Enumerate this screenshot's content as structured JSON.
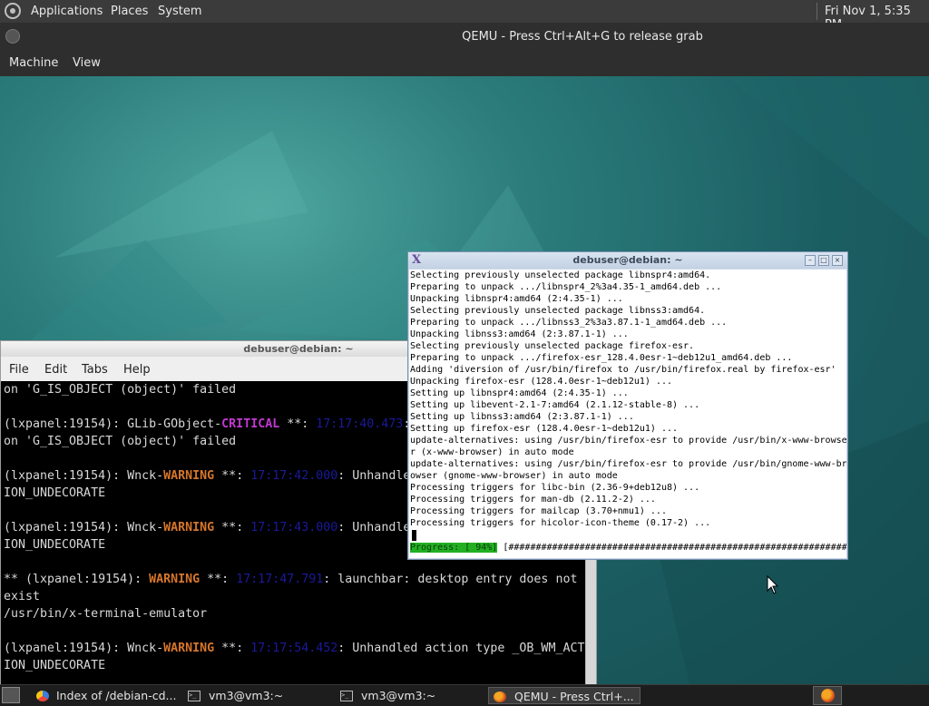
{
  "host_panel": {
    "menu": [
      "Applications",
      "Places",
      "System"
    ],
    "clock": "Fri Nov 1,  5:35 PM"
  },
  "qemu": {
    "title": "QEMU - Press Ctrl+Alt+G to release grab",
    "menu": [
      "Machine",
      "View"
    ]
  },
  "xterm": {
    "title": "debuser@debian: ~",
    "lines": [
      "Selecting previously unselected package libnspr4:amd64.",
      "Preparing to unpack .../libnspr4_2%3a4.35-1_amd64.deb ...",
      "Unpacking libnspr4:amd64 (2:4.35-1) ...",
      "Selecting previously unselected package libnss3:amd64.",
      "Preparing to unpack .../libnss3_2%3a3.87.1-1_amd64.deb ...",
      "Unpacking libnss3:amd64 (2:3.87.1-1) ...",
      "Selecting previously unselected package firefox-esr.",
      "Preparing to unpack .../firefox-esr_128.4.0esr-1~deb12u1_amd64.deb ...",
      "Adding 'diversion of /usr/bin/firefox to /usr/bin/firefox.real by firefox-esr'",
      "Unpacking firefox-esr (128.4.0esr-1~deb12u1) ...",
      "Setting up libnspr4:amd64 (2:4.35-1) ...",
      "Setting up libevent-2.1-7:amd64 (2.1.12-stable-8) ...",
      "Setting up libnss3:amd64 (2:3.87.1-1) ...",
      "Setting up firefox-esr (128.4.0esr-1~deb12u1) ...",
      "update-alternatives: using /usr/bin/firefox-esr to provide /usr/bin/x-www-browse",
      "r (x-www-browser) in auto mode",
      "update-alternatives: using /usr/bin/firefox-esr to provide /usr/bin/gnome-www-br",
      "owser (gnome-www-browser) in auto mode",
      "Processing triggers for libc-bin (2.36-9+deb12u8) ...",
      "Processing triggers for man-db (2.11.2-2) ...",
      "Processing triggers for mailcap (3.70+nmu1) ...",
      "Processing triggers for hicolor-icon-theme (0.17-2) ..."
    ],
    "progress_label": "Progress: [ 94%]",
    "progress_bar": " [##############################################################.....]",
    "progress_percent": 94
  },
  "lxterminal": {
    "title": "debuser@debian: ~",
    "menu": [
      "File",
      "Edit",
      "Tabs",
      "Help"
    ],
    "lines": [
      [
        {
          "t": "on 'G_IS_OBJECT (object)' failed"
        }
      ],
      [
        {
          "t": ""
        }
      ],
      [
        {
          "t": "(lxpanel:19154): GLib-GObject-"
        },
        {
          "t": "CRITICAL",
          "c": "crit"
        },
        {
          "t": " **: "
        },
        {
          "t": "17:17:40.473",
          "c": "ts"
        },
        {
          "t": ": g_object_unref: assertion"
        }
      ],
      [
        {
          "t": "on 'G_IS_OBJECT (object)' failed"
        }
      ],
      [
        {
          "t": ""
        }
      ],
      [
        {
          "t": "(lxpanel:19154): Wnck-"
        },
        {
          "t": "WARNING",
          "c": "warn"
        },
        {
          "t": " **: "
        },
        {
          "t": "17:17:42.000",
          "c": "ts"
        },
        {
          "t": ": Unhandled action type _OB_WM_ACT"
        }
      ],
      [
        {
          "t": "ION_UNDECORATE"
        }
      ],
      [
        {
          "t": ""
        }
      ],
      [
        {
          "t": "(lxpanel:19154): Wnck-"
        },
        {
          "t": "WARNING",
          "c": "warn"
        },
        {
          "t": " **: "
        },
        {
          "t": "17:17:43.000",
          "c": "ts"
        },
        {
          "t": ": Unhandled action type _OB_WM_ACT"
        }
      ],
      [
        {
          "t": "ION_UNDECORATE"
        }
      ],
      [
        {
          "t": ""
        }
      ],
      [
        {
          "t": "** (lxpanel:19154): "
        },
        {
          "t": "WARNING",
          "c": "warn"
        },
        {
          "t": " **: "
        },
        {
          "t": "17:17:47.791",
          "c": "ts"
        },
        {
          "t": ": launchbar: desktop entry does not"
        }
      ],
      [
        {
          "t": "exist"
        }
      ],
      [
        {
          "t": "/usr/bin/x-terminal-emulator"
        }
      ],
      [
        {
          "t": ""
        }
      ],
      [
        {
          "t": "(lxpanel:19154): Wnck-"
        },
        {
          "t": "WARNING",
          "c": "warn"
        },
        {
          "t": " **: "
        },
        {
          "t": "17:17:54.452",
          "c": "ts"
        },
        {
          "t": ": Unhandled action type _OB_WM_ACT"
        }
      ],
      [
        {
          "t": "ION_UNDECORATE"
        }
      ]
    ]
  },
  "taskbar": {
    "items": [
      {
        "label": "Index of /debian-cd...",
        "icon": "chrome-icon"
      },
      {
        "label": "vm3@vm3:~",
        "icon": "terminal-icon"
      },
      {
        "label": "vm3@vm3:~",
        "icon": "terminal-icon"
      },
      {
        "label": "QEMU - Press Ctrl+...",
        "icon": "qemu-icon"
      }
    ]
  },
  "colors": {
    "critical": "#c13ad0",
    "warning": "#d7762a",
    "timestamp": "#1a1a9a",
    "progress": "#22b022",
    "desktop": "#1b5e62"
  }
}
